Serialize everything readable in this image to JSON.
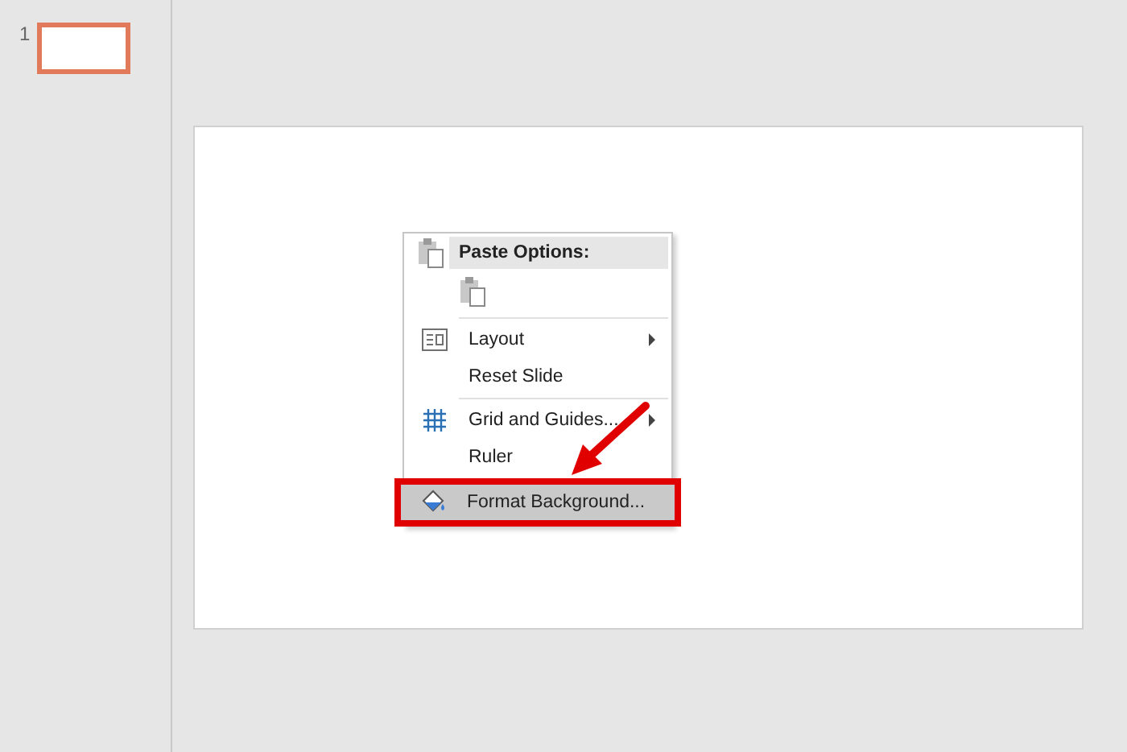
{
  "thumbnails": [
    {
      "number": "1",
      "selected": true
    }
  ],
  "context_menu": {
    "items": [
      {
        "kind": "header",
        "label": "Paste Options:"
      },
      {
        "kind": "paste-row"
      },
      {
        "kind": "separator"
      },
      {
        "kind": "item",
        "label": "Layout",
        "submenu": true,
        "highlighted": false
      },
      {
        "kind": "item",
        "label": "Reset Slide",
        "submenu": false,
        "highlighted": false
      },
      {
        "kind": "separator"
      },
      {
        "kind": "item",
        "label": "Grid and Guides...",
        "submenu": true,
        "highlighted": false
      },
      {
        "kind": "item",
        "label": "Ruler",
        "submenu": false,
        "highlighted": false
      },
      {
        "kind": "item",
        "label": "Format Background...",
        "submenu": false,
        "highlighted": true
      }
    ]
  }
}
